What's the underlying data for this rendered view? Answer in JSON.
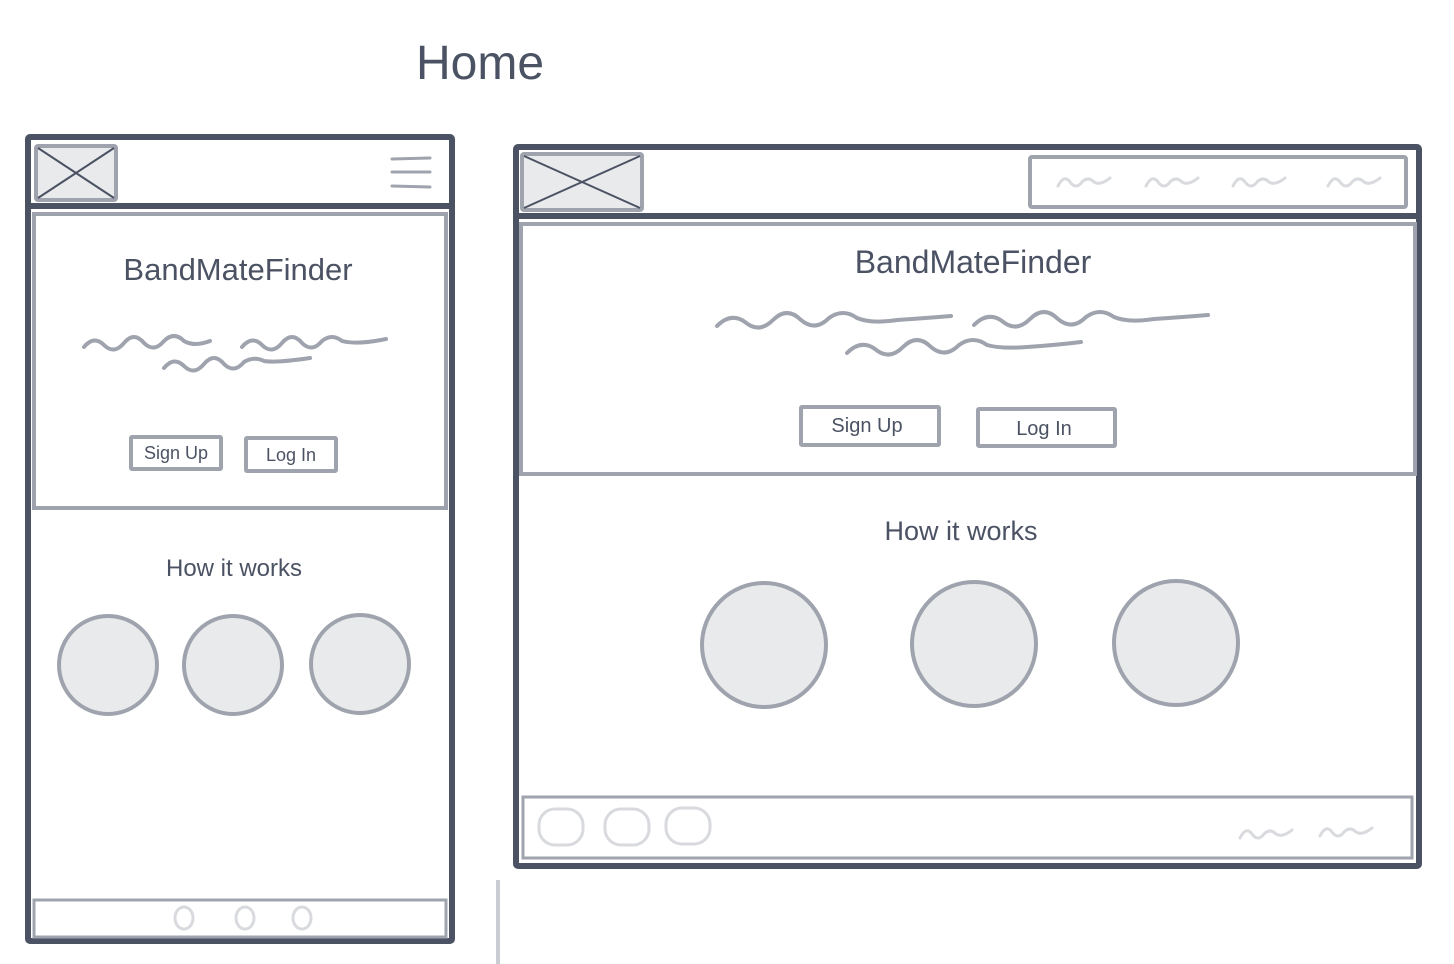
{
  "page": {
    "title": "Home"
  },
  "mobile": {
    "header": {
      "logo_icon": "image-placeholder-icon",
      "menu_icon": "hamburger-menu-icon"
    },
    "hero": {
      "brand": "BandMateFinder",
      "signup_label": "Sign Up",
      "login_label": "Log In"
    },
    "how": {
      "heading": "How it works",
      "steps": 3
    },
    "footer": {
      "icons": [
        "social-icon",
        "social-icon",
        "social-icon"
      ]
    }
  },
  "desktop": {
    "header": {
      "logo_icon": "image-placeholder-icon",
      "nav_links": 4
    },
    "hero": {
      "brand": "BandMateFinder",
      "signup_label": "Sign Up",
      "login_label": "Log In"
    },
    "how": {
      "heading": "How it works",
      "steps": 3
    },
    "footer": {
      "icons": [
        "social-icon",
        "social-icon",
        "social-icon"
      ],
      "links": 2
    }
  },
  "colors": {
    "stroke_dark": "#4b5263",
    "stroke_light": "#9ea3ad",
    "fill_light": "#e9eaec",
    "footer_stroke": "#d8dade"
  }
}
